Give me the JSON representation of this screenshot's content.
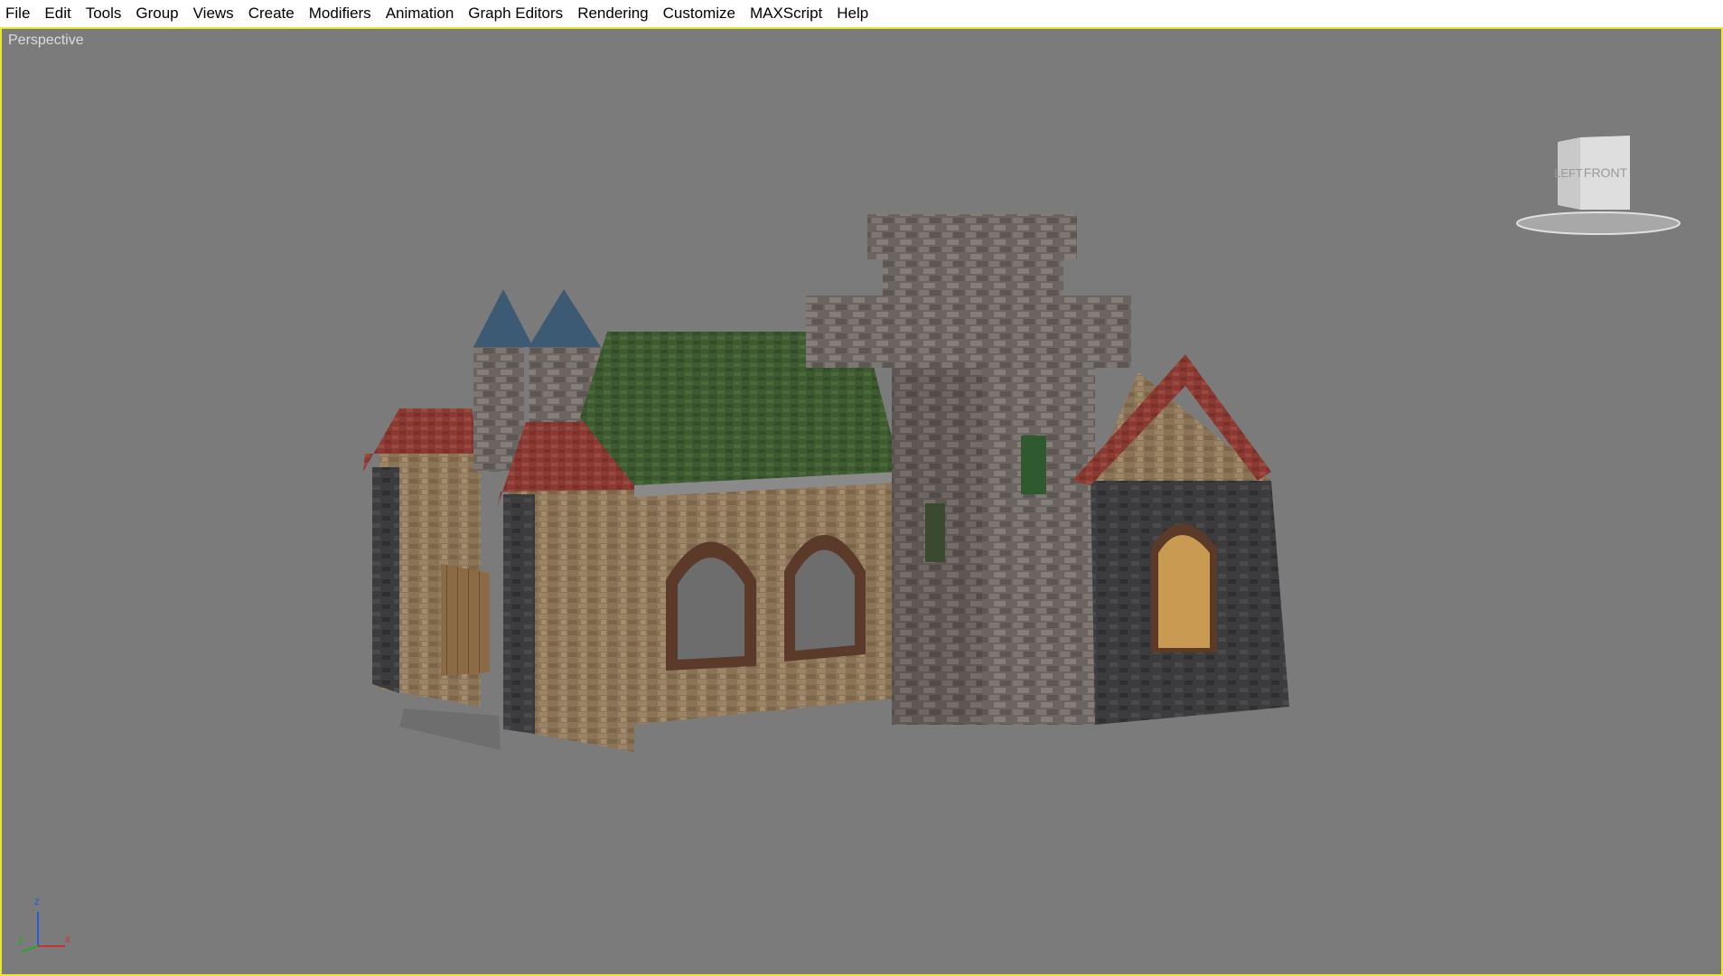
{
  "menubar": {
    "items": [
      {
        "label": "File"
      },
      {
        "label": "Edit"
      },
      {
        "label": "Tools"
      },
      {
        "label": "Group"
      },
      {
        "label": "Views"
      },
      {
        "label": "Create"
      },
      {
        "label": "Modifiers"
      },
      {
        "label": "Animation"
      },
      {
        "label": "Graph Editors"
      },
      {
        "label": "Rendering"
      },
      {
        "label": "Customize"
      },
      {
        "label": "MAXScript"
      },
      {
        "label": "Help"
      }
    ]
  },
  "viewport": {
    "label": "Perspective",
    "border_color": "#e8e832",
    "background": "#7b7b7b"
  },
  "viewcube": {
    "left_face": "LEFT",
    "front_face": "FRONT"
  },
  "axis_tripod": {
    "z": "z",
    "y": "y",
    "x": "x"
  }
}
